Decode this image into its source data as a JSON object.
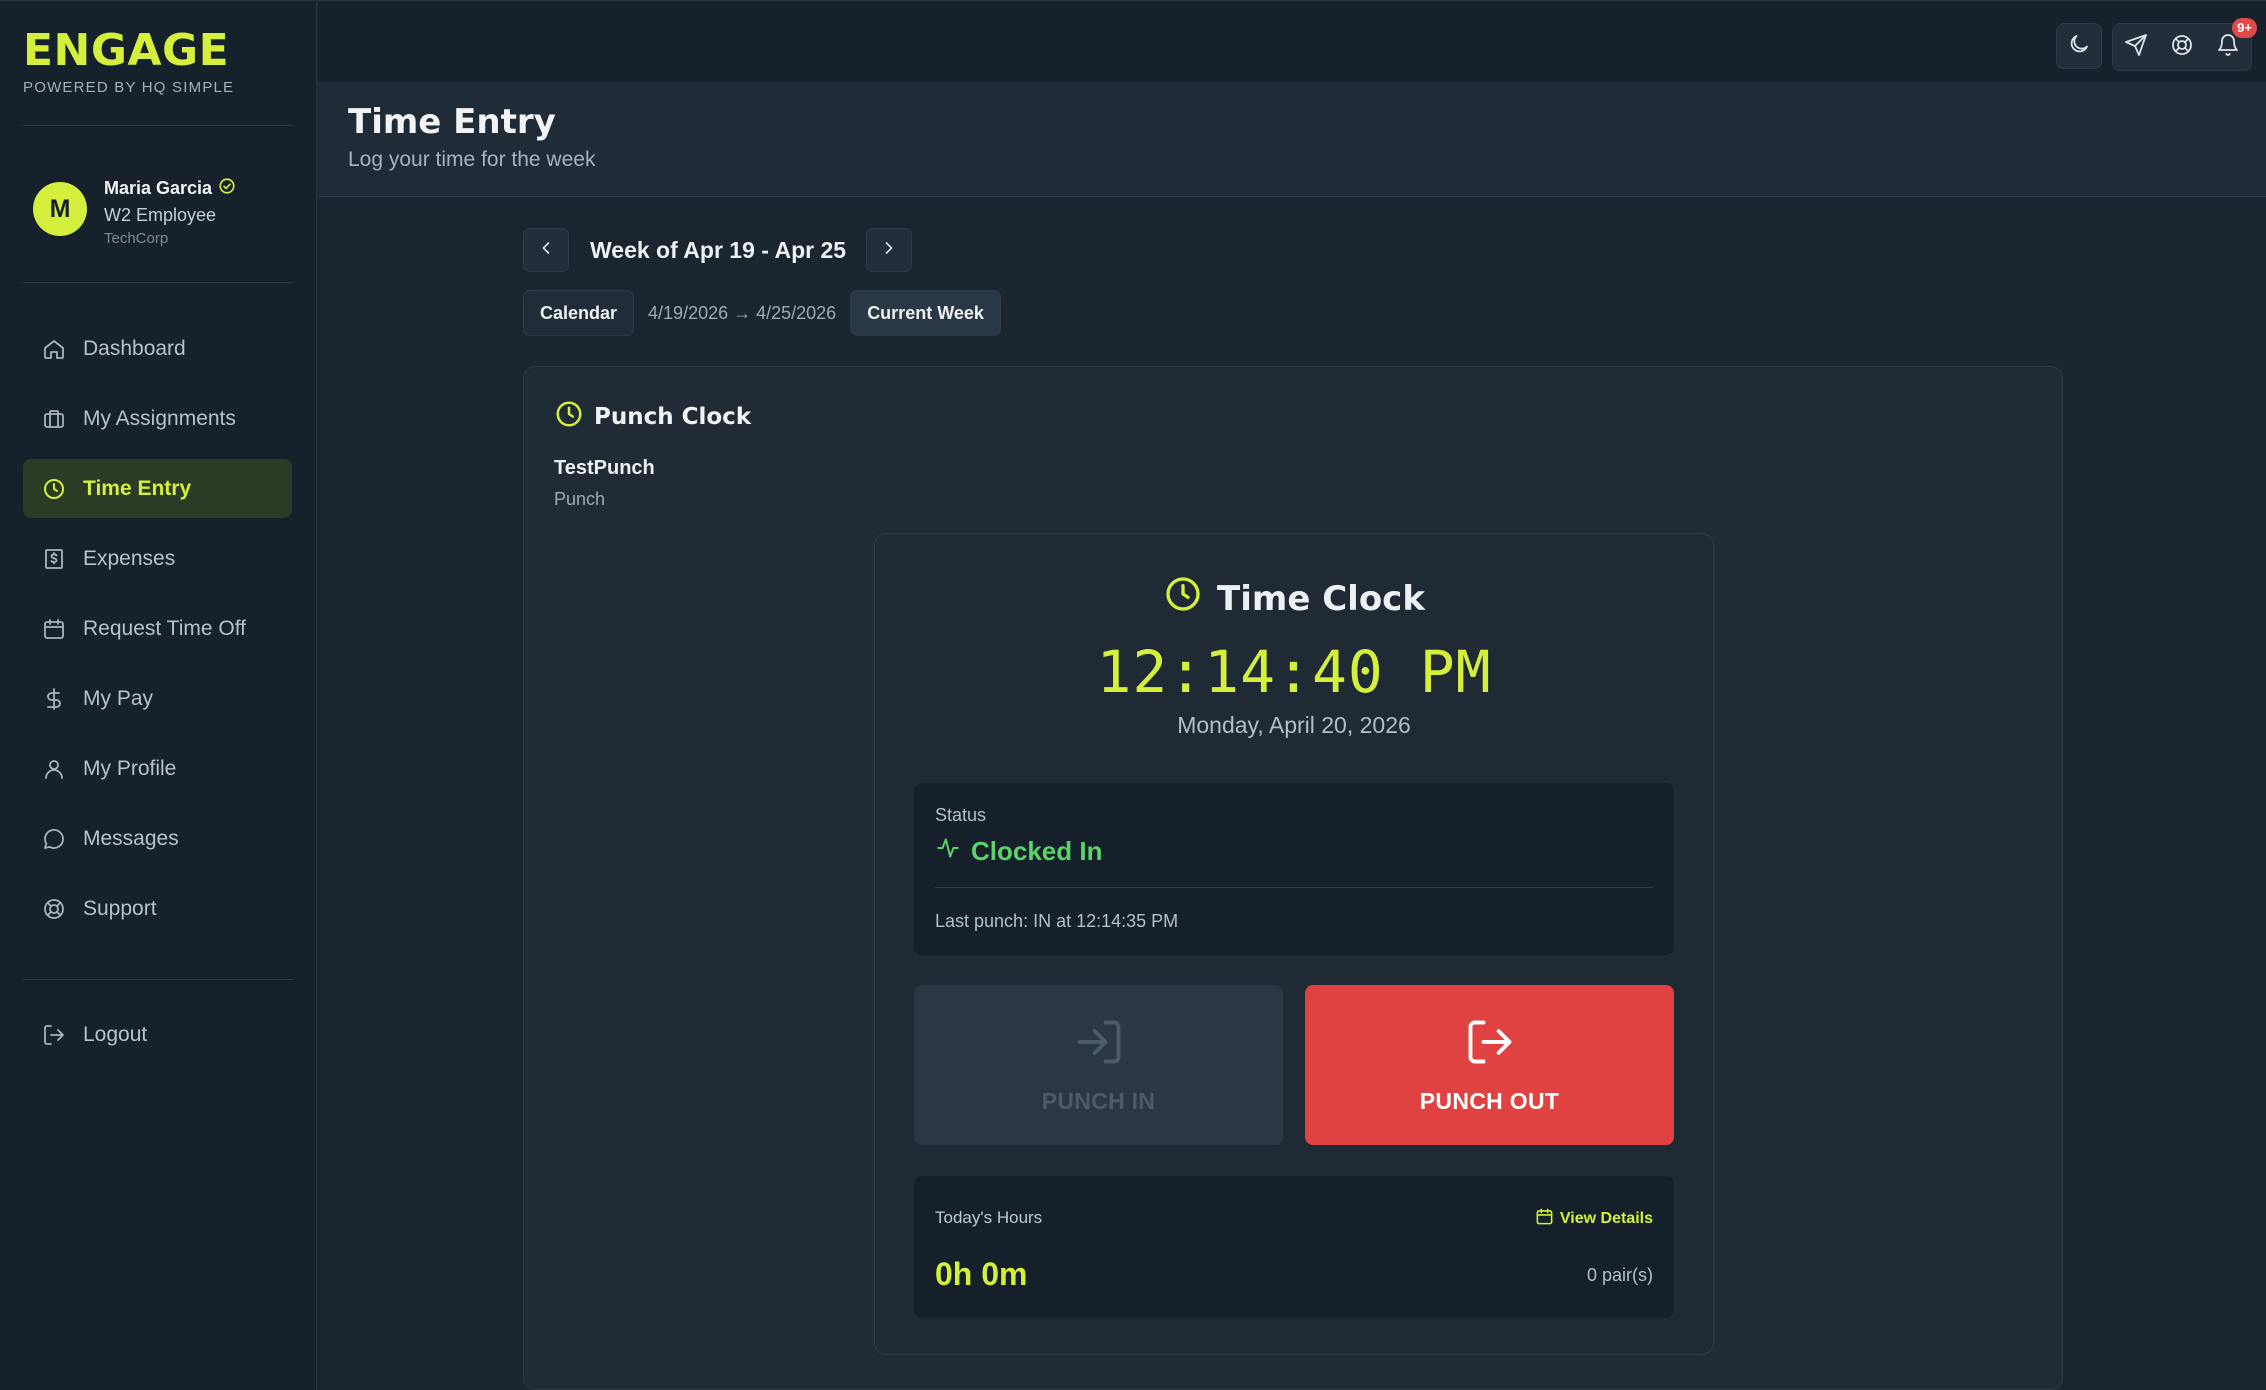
{
  "brand": {
    "name": "ENGAGE",
    "subtitle": "POWERED BY HQ SIMPLE",
    "accent": "#d4f03c"
  },
  "user": {
    "initial": "M",
    "name": "Maria Garcia",
    "role": "W2 Employee",
    "company": "TechCorp"
  },
  "sidebar": {
    "items": [
      {
        "label": "Dashboard",
        "icon": "home-icon"
      },
      {
        "label": "My Assignments",
        "icon": "briefcase-icon"
      },
      {
        "label": "Time Entry",
        "icon": "clock-icon",
        "active": true
      },
      {
        "label": "Expenses",
        "icon": "receipt-icon"
      },
      {
        "label": "Request Time Off",
        "icon": "calendar-icon"
      },
      {
        "label": "My Pay",
        "icon": "dollar-icon"
      },
      {
        "label": "My Profile",
        "icon": "user-icon"
      },
      {
        "label": "Messages",
        "icon": "message-icon"
      },
      {
        "label": "Support",
        "icon": "lifebuoy-icon"
      }
    ],
    "logout": "Logout"
  },
  "topbar": {
    "notification_badge": "9+"
  },
  "page": {
    "title": "Time Entry",
    "subtitle": "Log your time for the week"
  },
  "week": {
    "label": "Week of Apr 19 - Apr 25",
    "calendar_label": "Calendar",
    "range": "4/19/2026 → 4/25/2026",
    "current_week_label": "Current Week"
  },
  "punch_clock": {
    "title": "Punch Clock",
    "job_name": "TestPunch",
    "job_type": "Punch",
    "clock_title": "Time Clock",
    "time": "12:14:40 PM",
    "date": "Monday, April 20, 2026",
    "status_label": "Status",
    "status_value": "Clocked In",
    "status_color": "#5bd36a",
    "last_punch": "Last punch: IN at 12:14:35 PM",
    "punch_in_label": "PUNCH IN",
    "punch_out_label": "PUNCH OUT",
    "punch_out_color": "#e04141",
    "todays_hours_label": "Today's Hours",
    "view_details_label": "View Details",
    "todays_hours_value": "0h 0m",
    "pairs": "0 pair(s)"
  }
}
